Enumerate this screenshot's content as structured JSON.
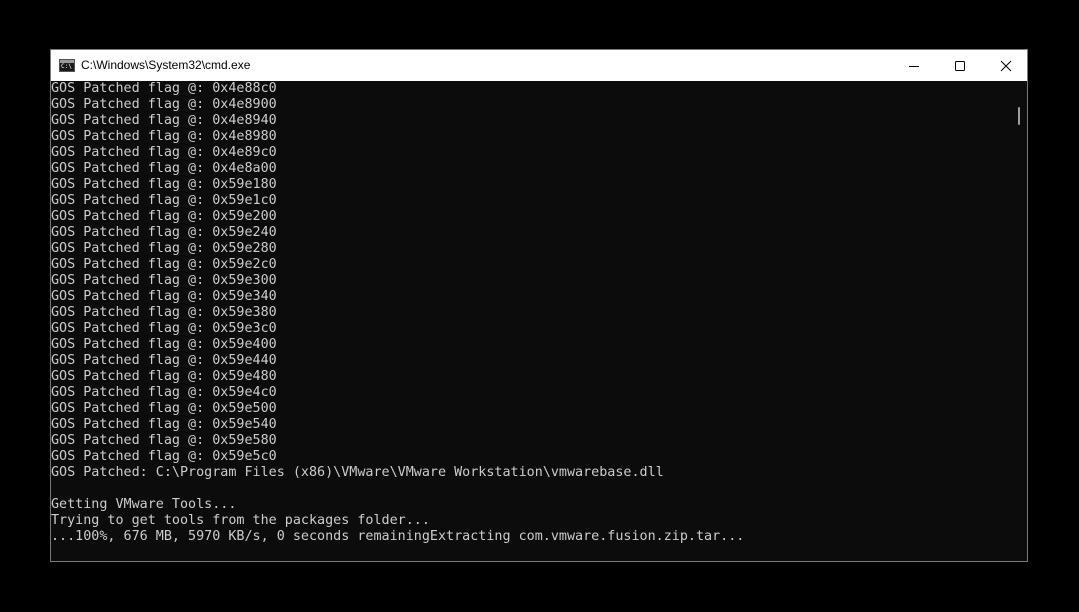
{
  "window": {
    "title": "C:\\Windows\\System32\\cmd.exe",
    "icon": "cmd-icon"
  },
  "caption_buttons": {
    "minimize": "minimize-icon",
    "maximize": "maximize-icon",
    "close": "close-icon"
  },
  "console": {
    "lines": [
      "GOS Patched flag @: 0x4e88c0",
      "GOS Patched flag @: 0x4e8900",
      "GOS Patched flag @: 0x4e8940",
      "GOS Patched flag @: 0x4e8980",
      "GOS Patched flag @: 0x4e89c0",
      "GOS Patched flag @: 0x4e8a00",
      "GOS Patched flag @: 0x59e180",
      "GOS Patched flag @: 0x59e1c0",
      "GOS Patched flag @: 0x59e200",
      "GOS Patched flag @: 0x59e240",
      "GOS Patched flag @: 0x59e280",
      "GOS Patched flag @: 0x59e2c0",
      "GOS Patched flag @: 0x59e300",
      "GOS Patched flag @: 0x59e340",
      "GOS Patched flag @: 0x59e380",
      "GOS Patched flag @: 0x59e3c0",
      "GOS Patched flag @: 0x59e400",
      "GOS Patched flag @: 0x59e440",
      "GOS Patched flag @: 0x59e480",
      "GOS Patched flag @: 0x59e4c0",
      "GOS Patched flag @: 0x59e500",
      "GOS Patched flag @: 0x59e540",
      "GOS Patched flag @: 0x59e580",
      "GOS Patched flag @: 0x59e5c0",
      "GOS Patched: C:\\Program Files (x86)\\VMware\\VMware Workstation\\vmwarebase.dll",
      "",
      "Getting VMware Tools...",
      "Trying to get tools from the packages folder...",
      "...100%, 676 MB, 5970 KB/s, 0 seconds remainingExtracting com.vmware.fusion.zip.tar..."
    ]
  }
}
